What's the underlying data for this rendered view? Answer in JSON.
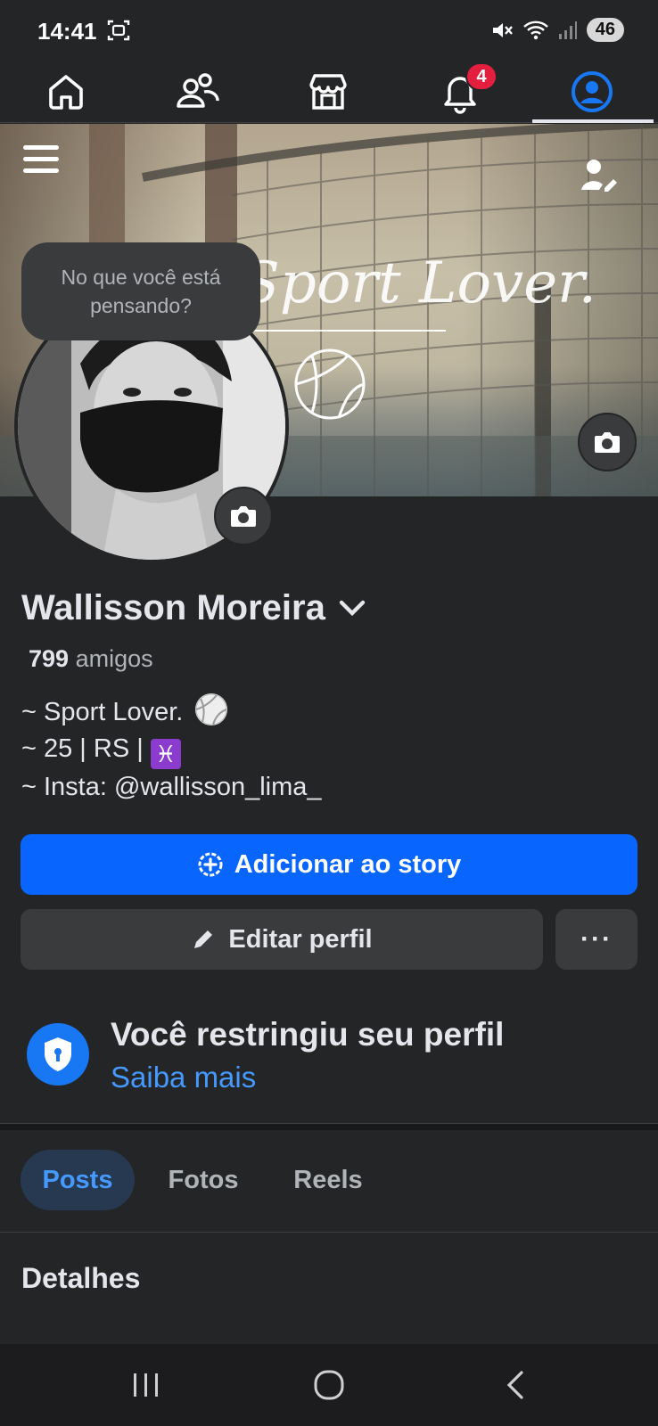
{
  "status_bar": {
    "time": "14:41",
    "battery": "46"
  },
  "nav": {
    "items": [
      {
        "name": "home",
        "icon": "home-icon"
      },
      {
        "name": "friends",
        "icon": "friends-icon"
      },
      {
        "name": "marketplace",
        "icon": "marketplace-icon"
      },
      {
        "name": "notifications",
        "icon": "bell-icon",
        "badge": "4"
      },
      {
        "name": "profile",
        "icon": "profile-icon",
        "active": true
      }
    ],
    "notification_count": "4"
  },
  "cover": {
    "script_text": "Sport Lover."
  },
  "thought_bubble": "No que você está pensando?",
  "profile": {
    "name": "Wallisson Moreira",
    "friends_count": "799",
    "friends_label": "amigos",
    "bio_line1": "~ Sport Lover.",
    "bio_line2": "~ 25 | RS |",
    "bio_line3": "~ Insta: @wallisson_lima_",
    "pisces_symbol": "♓"
  },
  "actions": {
    "add_story": "Adicionar ao story",
    "edit_profile": "Editar perfil",
    "more": "···"
  },
  "restriction": {
    "title": "Você restringiu seu perfil",
    "link": "Saiba mais"
  },
  "tabs": [
    {
      "label": "Posts",
      "active": true
    },
    {
      "label": "Fotos",
      "active": false
    },
    {
      "label": "Reels",
      "active": false
    }
  ],
  "details_title": "Detalhes",
  "colors": {
    "background": "#242526",
    "primary": "#0866ff",
    "link": "#4599ff",
    "badge": "#e41e3f"
  }
}
